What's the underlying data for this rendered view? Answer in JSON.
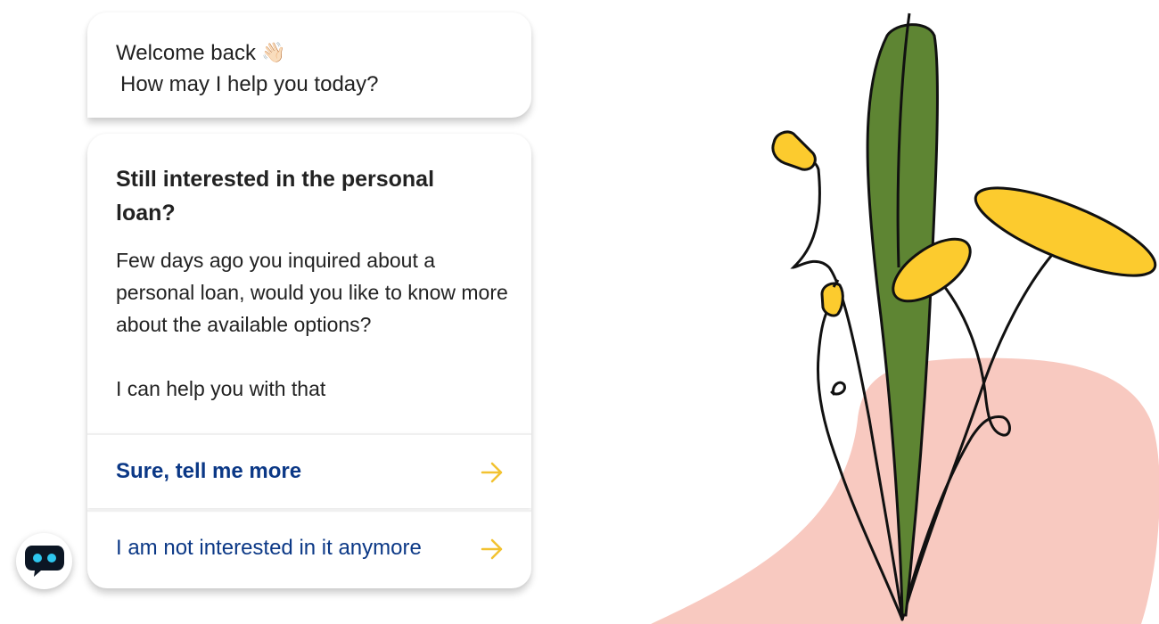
{
  "greeting": {
    "line1": "Welcome back",
    "wave_icon": "👋🏻",
    "line2": "How may I help you today?"
  },
  "offer": {
    "title": "Still interested in the personal loan?",
    "body_paragraph": "Few days ago you inquired about a personal loan, would you like to know more about the available options?",
    "body_followup": "I can help you with that",
    "options": [
      {
        "label": "Sure, tell me more",
        "icon": "arrow-right-icon"
      },
      {
        "label": "I am not interested in it anymore",
        "icon": "arrow-right-icon"
      }
    ]
  },
  "bot_button": {
    "icon": "chatbot-icon"
  },
  "colors": {
    "link_blue": "#0b3886",
    "arrow_yellow": "#f2c230",
    "plant_green": "#5e8533",
    "flower_yellow": "#fccb2e",
    "blob_pink": "#f8c9c0",
    "bot_eyes": "#2ec7ef"
  }
}
